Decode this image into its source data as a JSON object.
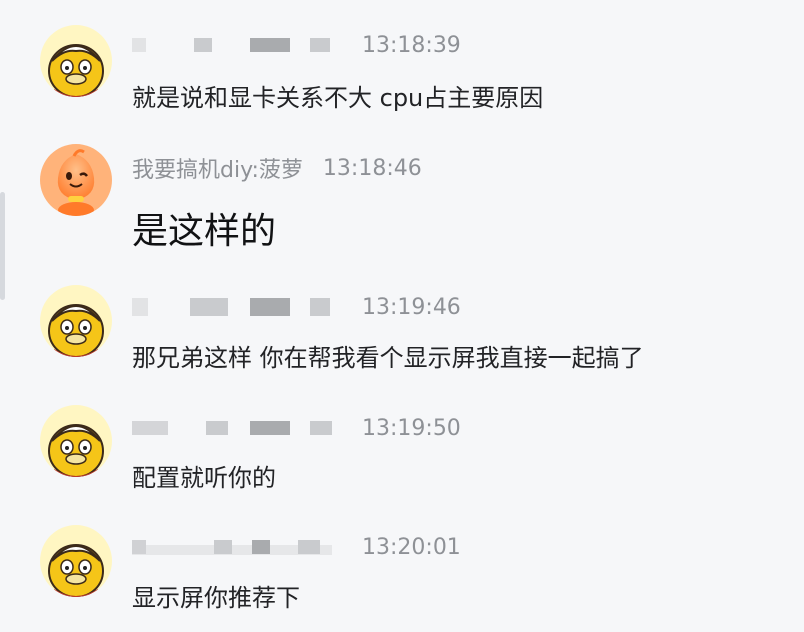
{
  "messages": [
    {
      "sender": "",
      "time": "13:18:39",
      "text": "就是说和显卡关系不大 cpu占主要原因",
      "avatar": "yellow-duck"
    },
    {
      "sender": "我要搞机diy:菠萝",
      "time": "13:18:46",
      "text": "是这样的",
      "avatar": "orange-mascot"
    },
    {
      "sender": "",
      "time": "13:19:46",
      "text": "那兄弟这样 你在帮我看个显示屏我直接一起搞了",
      "avatar": "yellow-duck"
    },
    {
      "sender": "",
      "time": "13:19:50",
      "text": "配置就听你的",
      "avatar": "yellow-duck"
    },
    {
      "sender": "",
      "time": "13:20:01",
      "text": "显示屏你推荐下",
      "avatar": "yellow-duck"
    }
  ],
  "colors": {
    "background": "#f6f7f9",
    "meta_text": "#8e9196",
    "message_text": "#222326"
  }
}
